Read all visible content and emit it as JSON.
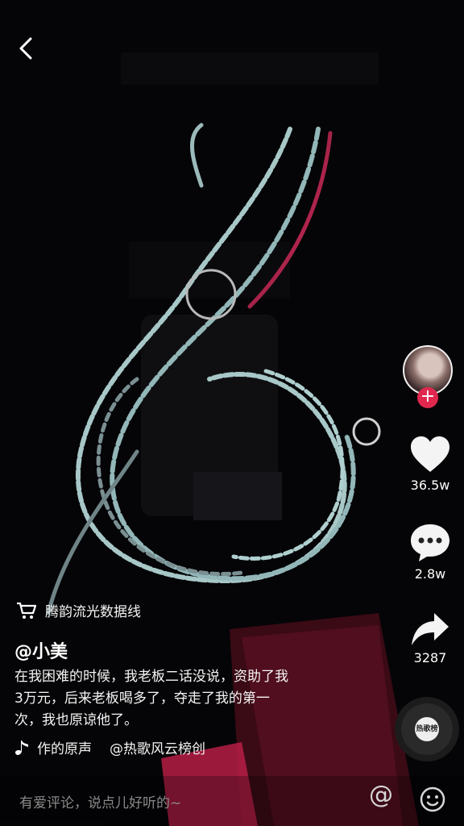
{
  "header": {
    "back_icon": "chevron-left-icon"
  },
  "sidebar": {
    "follow_icon": "plus-icon",
    "like_count": "36.5w",
    "comment_count": "2.8w",
    "share_count": "3287",
    "like_icon": "heart-icon",
    "comment_icon": "speech-bubble-icon",
    "share_icon": "share-arrow-icon",
    "disc_label": "热歌榜",
    "follow_color": "#e0284f"
  },
  "product": {
    "icon": "shopping-cart-icon",
    "name": "腾韵流光数据线"
  },
  "post": {
    "username": "@小美",
    "caption": "在我困难的时候，我老板二话没说，资助了我\n3万元，后来老板喝多了，夺走了我的第一\n次，我也原谅他了。",
    "music_original": "作的原声",
    "music_tag": "@热歌风云榜创"
  },
  "comment": {
    "placeholder": "有爱评论，说点儿好听的~",
    "at_label": "@",
    "emoji_icon": "smiley-icon"
  }
}
